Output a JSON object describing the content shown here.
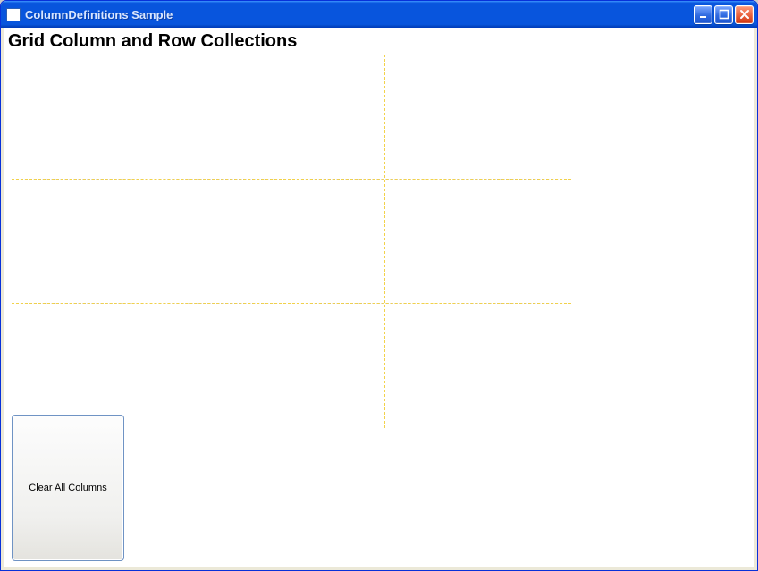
{
  "window": {
    "title": "ColumnDefinitions Sample"
  },
  "main": {
    "heading": "Grid Column and Row Collections",
    "clearAllLabel": "Clear All Columns"
  }
}
